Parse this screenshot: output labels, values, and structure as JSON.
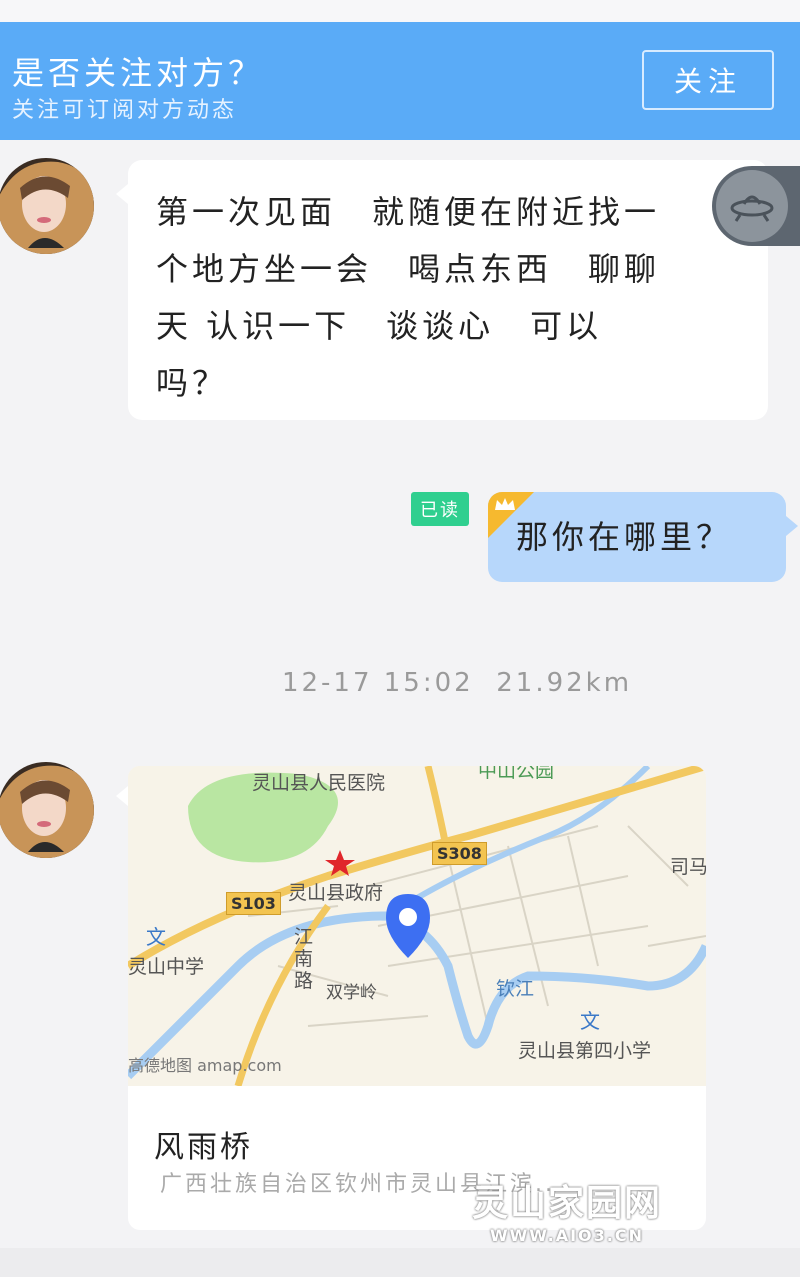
{
  "follow_bar": {
    "title": "是否关注对方？",
    "subtitle": "关注可订阅对方动态",
    "button_label": "关注"
  },
  "messages": [
    {
      "direction": "incoming",
      "lines": [
        "第一次见面　就随便在附近找一",
        "个地方坐一会　喝点东西　聊聊",
        "天 认识一下　谈谈心　可以",
        "吗？"
      ]
    },
    {
      "direction": "outgoing",
      "text": "那你在哪里？",
      "read_badge": "已读"
    }
  ],
  "timestamp": {
    "date": "12-17",
    "time": "15:02",
    "distance": "21.92km"
  },
  "location_card": {
    "map_labels": {
      "hospital": "灵山县人民医院",
      "government": "灵山县政府",
      "park": "中山公园",
      "middle_school": "灵山中学",
      "road_jiangnan": "江南路",
      "shuangxueling": "双学岭",
      "qinjiang": "钦江",
      "fourth_primary": "灵山县第四小学",
      "sima": "司马",
      "road_s308": "S308",
      "road_s103": "S103",
      "map_credit": "高德地图 amap.com"
    },
    "name": "风雨桥",
    "address": "广西壮族自治区钦州市灵山县江滨..."
  },
  "watermark": {
    "title": "灵山家园网",
    "url": "WWW.AIO3.CN"
  },
  "icons": {
    "float_button": "ufo-icon",
    "crown": "crown-icon",
    "map_pin": "map-pin-icon",
    "government_marker": "star-icon"
  },
  "colors": {
    "header_blue": "#5aabf7",
    "outgoing_bubble": "#b7d7fb",
    "read_badge": "#2fcf8f",
    "crown": "#f6b92f",
    "pin": "#3d6ff2"
  }
}
